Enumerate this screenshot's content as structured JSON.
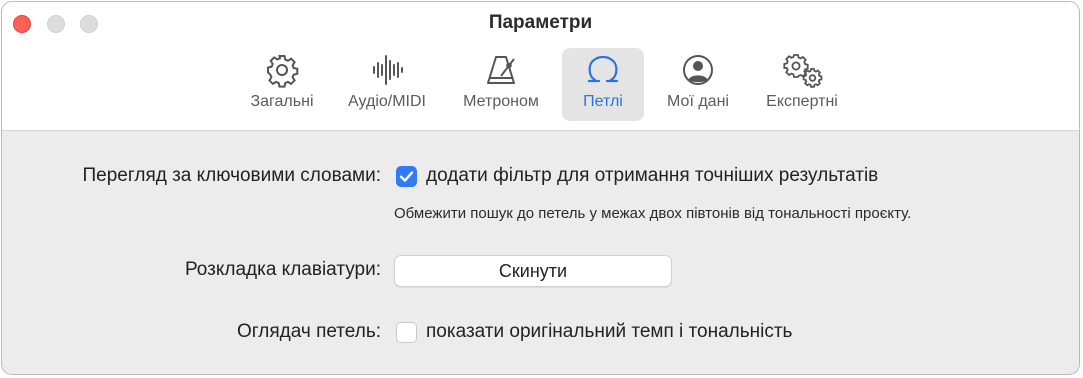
{
  "window": {
    "title": "Параметри"
  },
  "tabs": [
    {
      "id": "general",
      "label": "Загальні",
      "icon": "gear-icon",
      "active": false
    },
    {
      "id": "audio",
      "label": "Аудіо/MIDI",
      "icon": "waveform-icon",
      "active": false
    },
    {
      "id": "metronome",
      "label": "Метроном",
      "icon": "metronome-icon",
      "active": false
    },
    {
      "id": "loops",
      "label": "Петлі",
      "icon": "loop-icon",
      "active": true
    },
    {
      "id": "mydata",
      "label": "Мої дані",
      "icon": "person-icon",
      "active": false
    },
    {
      "id": "advanced",
      "label": "Експертні",
      "icon": "gears-icon",
      "active": false
    }
  ],
  "settings": {
    "keyword": {
      "label": "Перегляд за ключовими словами:",
      "checkbox_label": "додати фільтр для отримання точніших результатів",
      "checked": true,
      "hint": "Обмежити пошук до петель у межах двох півтонів від тональності проєкту."
    },
    "keyboard": {
      "label": "Розкладка клавіатури:",
      "button_label": "Скинути"
    },
    "browser": {
      "label": "Оглядач петель:",
      "checkbox_label": "показати оригінальний темп і тональність",
      "checked": false
    }
  },
  "colors": {
    "accent": "#2f7bf6",
    "close": "#fe5f57"
  }
}
